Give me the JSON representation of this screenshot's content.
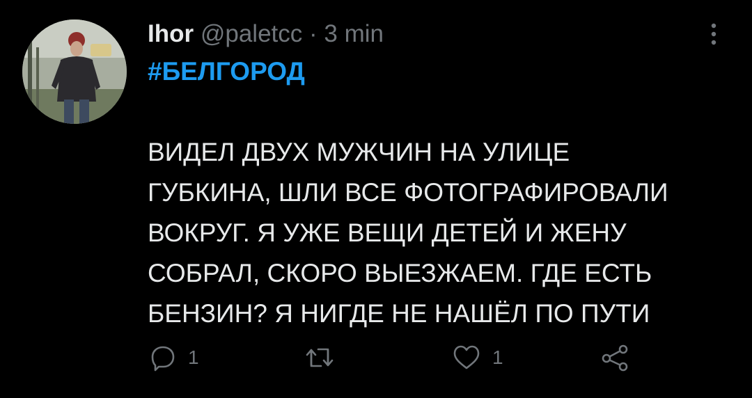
{
  "tweet": {
    "author_name": "Ihor",
    "handle": "@paletcc",
    "separator": "·",
    "time": "3 min",
    "hashtag": "#БЕЛГОРОД",
    "lines": [
      "ВИДЕЛ ДВУХ МУЖЧИН НА УЛИЦЕ",
      "ГУБКИНА, ШЛИ ВСЕ ФОТОГРАФИРОВАЛИ",
      "ВОКРУГ. Я УЖЕ ВЕЩИ ДЕТЕЙ И ЖЕНУ",
      "СОБРАЛ, СКОРО ВЫЕЗЖАЕМ. ГДЕ ЕСТЬ",
      "БЕНЗИН? Я НИГДЕ НЕ НАШЁЛ ПО ПУТИ"
    ]
  },
  "actions": {
    "reply_count": "1",
    "like_count": "1",
    "icons": [
      "reply-icon",
      "retweet-icon",
      "like-icon",
      "share-icon"
    ]
  },
  "colors": {
    "background": "#000000",
    "text": "#e7e9ea",
    "muted": "#71767b",
    "accent": "#1d9bf0"
  }
}
